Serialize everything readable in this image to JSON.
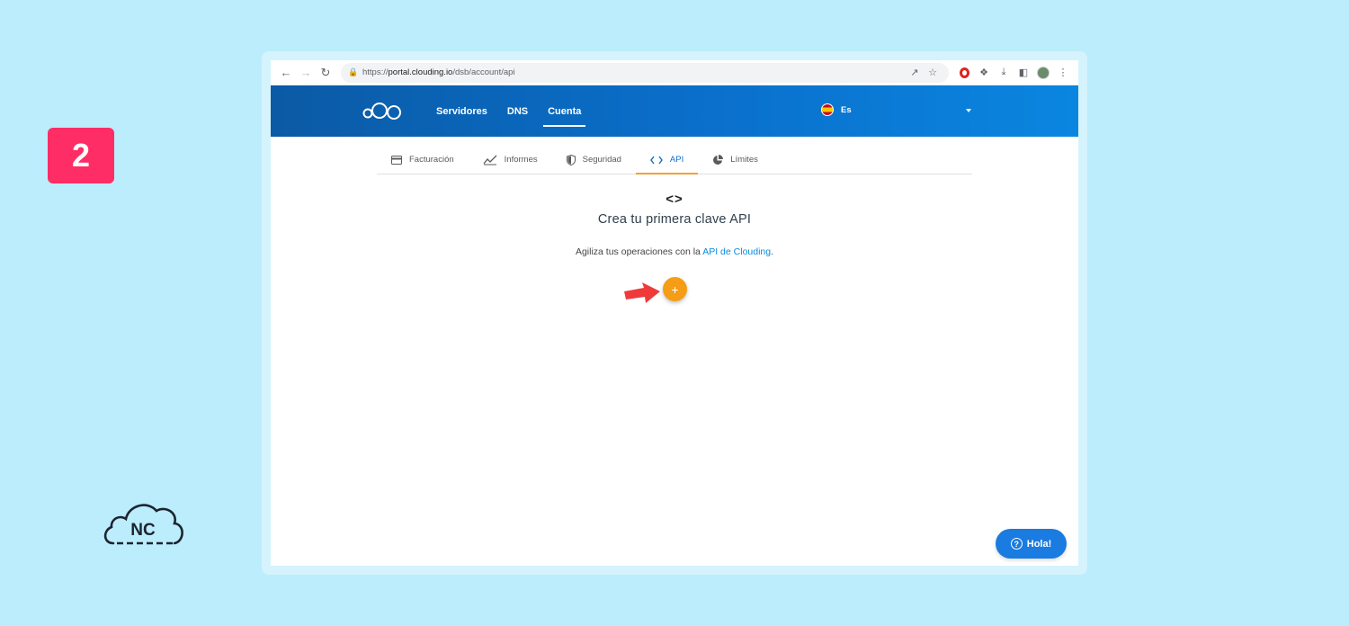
{
  "step": {
    "number": "2",
    "color": "#ff2d65"
  },
  "brand_logo": {
    "icon": "nc-cloud-logo",
    "text": "NC"
  },
  "browser": {
    "url_prefix": "https://",
    "url_host": "portal.clouding.io",
    "url_path": "/dsb/account/api"
  },
  "header": {
    "nav": [
      {
        "label": "Servidores",
        "active": false
      },
      {
        "label": "DNS",
        "active": false
      },
      {
        "label": "Cuenta",
        "active": true
      }
    ],
    "language": "Es"
  },
  "tabs": [
    {
      "label": "Facturación",
      "icon": "credit-card-icon",
      "active": false
    },
    {
      "label": "Informes",
      "icon": "chart-icon",
      "active": false
    },
    {
      "label": "Seguridad",
      "icon": "shield-icon",
      "active": false
    },
    {
      "label": "API",
      "icon": "code-icon",
      "active": true
    },
    {
      "label": "Límites",
      "icon": "pie-chart-icon",
      "active": false
    }
  ],
  "empty_state": {
    "icon": "<>",
    "title": "Crea tu primera clave API",
    "text_before": "Agiliza tus operaciones con la ",
    "link": "API de Clouding",
    "text_after": "."
  },
  "add_button": {
    "label": "+",
    "color": "#f59d16"
  },
  "help_button": {
    "icon": "?",
    "label": "Hola!"
  },
  "colors": {
    "header": "#0a70cc",
    "accent": "#f3a033",
    "background": "#bbedfc"
  }
}
